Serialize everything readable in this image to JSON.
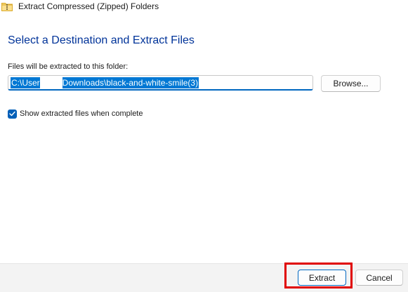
{
  "window": {
    "title": "Extract Compressed (Zipped) Folders",
    "title_icon": "zip-folder-icon"
  },
  "content": {
    "heading": "Select a Destination and Extract Files",
    "destination_label": "Files will be extracted to this folder:",
    "path_prefix": "C:\\User",
    "path_suffix": "Downloads\\black-and-white-smile(3)",
    "browse_label": "Browse...",
    "show_files_label": "Show extracted files when complete",
    "show_files_checked": true
  },
  "footer": {
    "extract_label": "Extract",
    "cancel_label": "Cancel"
  },
  "colors": {
    "heading": "#003399",
    "selection": "#0078d4",
    "checkbox": "#005fb8",
    "highlight": "#e00000",
    "footer_bg": "#f3f3f3"
  }
}
